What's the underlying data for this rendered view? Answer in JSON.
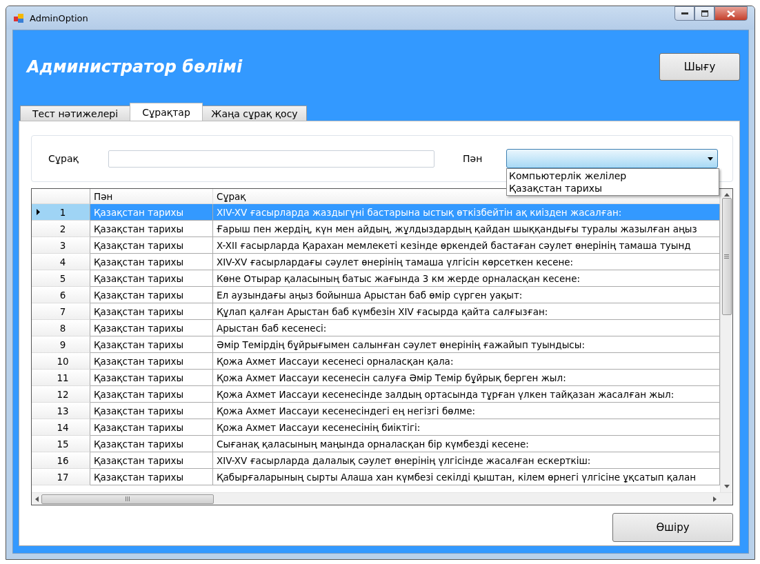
{
  "window": {
    "title": "AdminOption"
  },
  "header": {
    "title": "Администратор бөлімі",
    "exit_button": "Шығу"
  },
  "tabs": [
    {
      "label": "Тест нәтижелері",
      "selected": false
    },
    {
      "label": "Сұрақтар",
      "selected": true
    },
    {
      "label": "Жаңа сұрақ қосу",
      "selected": false
    }
  ],
  "filter": {
    "question_label": "Сұрақ",
    "subject_label": "Пән",
    "subject_dropdown": {
      "expanded": true,
      "options": [
        "Компьютерлік желілер",
        "Қазақстан тарихы"
      ]
    }
  },
  "table": {
    "columns": [
      "Пән",
      "Сұрақ"
    ],
    "rows": [
      {
        "number": "1",
        "subject": "Қазақстан тарихы",
        "question": "XIV-XV ғасырларда жаздыгүні бастарына ыстық өткізбейтін ақ киізден жасалған:",
        "selected": true
      },
      {
        "number": "2",
        "subject": "Қазақстан тарихы",
        "question": "Ғарыш пен жердің, күн мен айдың, жұлдыздардың қайдан шыққандығы туралы жазылған аңыз",
        "selected": false
      },
      {
        "number": "3",
        "subject": "Қазақстан тарихы",
        "question": "X-XII ғасырларда Қарахан мемлекеті кезінде өркендей бастаған сәулет өнерінің тамаша туынд",
        "selected": false
      },
      {
        "number": "4",
        "subject": "Қазақстан тарихы",
        "question": "XIV-XV ғасырлардағы сәулет өнерінің тамаша үлгісін көрсеткен кесене:",
        "selected": false
      },
      {
        "number": "5",
        "subject": "Қазақстан тарихы",
        "question": "Көне Отырар қаласының батыс жағында 3 км жерде орналасқан кесене:",
        "selected": false
      },
      {
        "number": "6",
        "subject": "Қазақстан тарихы",
        "question": "Ел аузындағы аңыз бойынша Арыстан баб өмір сүрген уақыт:",
        "selected": false
      },
      {
        "number": "7",
        "subject": "Қазақстан тарихы",
        "question": "Құлап қалған Арыстан баб күмбезін XIV ғасырда қайта салғызған:",
        "selected": false
      },
      {
        "number": "8",
        "subject": "Қазақстан тарихы",
        "question": "Арыстан баб кесенесі:",
        "selected": false
      },
      {
        "number": "9",
        "subject": "Қазақстан тарихы",
        "question": "Әмір Темірдің бұйрығымен салынған сәулет өнерінің ғажайып туындысы:",
        "selected": false
      },
      {
        "number": "10",
        "subject": "Қазақстан тарихы",
        "question": "Қожа Ахмет Иассауи кесенесі орналасқан қала:",
        "selected": false
      },
      {
        "number": "11",
        "subject": "Қазақстан тарихы",
        "question": "Қожа Ахмет Иассауи кесенесін салуға Әмір Темір бұйрық берген жыл:",
        "selected": false
      },
      {
        "number": "12",
        "subject": "Қазақстан тарихы",
        "question": "Қожа Ахмет Иассауи кесенесінде залдың ортасында тұрған үлкен тайқазан жасалған жыл:",
        "selected": false
      },
      {
        "number": "13",
        "subject": "Қазақстан тарихы",
        "question": "Қожа Ахмет Иассауи кесенесіндегі ең негізгі бөлме:",
        "selected": false
      },
      {
        "number": "14",
        "subject": "Қазақстан тарихы",
        "question": "Қожа Ахмет Иассауи кесенесінің биіктігі:",
        "selected": false
      },
      {
        "number": "15",
        "subject": "Қазақстан тарихы",
        "question": "Сығанақ қаласының маңында орналасқан бір күмбезді кесене:",
        "selected": false
      },
      {
        "number": "16",
        "subject": "Қазақстан тарихы",
        "question": "XIV-XV ғасырларда далалық сәулет өнерінің үлгісінде жасалған ескерткіш:",
        "selected": false
      },
      {
        "number": "17",
        "subject": "Қазақстан тарихы",
        "question": "Қабырғаларының сырты Алаша хан күмбезі секілді қыштан, кілем өрнегі үлгісіне ұқсатып қалан",
        "selected": false
      }
    ]
  },
  "delete_button": "Өшіру"
}
